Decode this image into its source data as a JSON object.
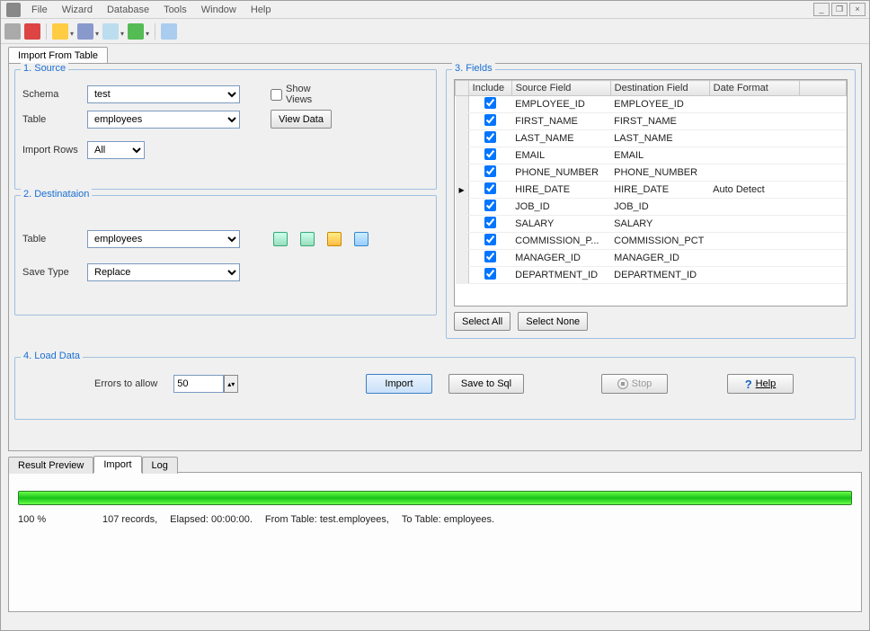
{
  "menu": {
    "items": [
      "File",
      "Wizard",
      "Database",
      "Tools",
      "Window",
      "Help"
    ]
  },
  "tab_main": "Import From Table",
  "source": {
    "legend": "1. Source",
    "schema_label": "Schema",
    "schema_value": "test",
    "table_label": "Table",
    "table_value": "employees",
    "show_views": "Show Views",
    "view_data": "View Data",
    "import_rows_label": "Import Rows",
    "import_rows_value": "All"
  },
  "dest": {
    "legend": "2. Destinataion",
    "table_label": "Table",
    "table_value": "employees",
    "save_type_label": "Save Type",
    "save_type_value": "Replace"
  },
  "fields": {
    "legend": "3. Fields",
    "headers": {
      "include": "Include",
      "source": "Source Field",
      "dest": "Destination Field",
      "datefmt": "Date Format"
    },
    "rows": [
      {
        "inc": true,
        "src": "EMPLOYEE_ID",
        "dst": "EMPLOYEE_ID",
        "fmt": "",
        "cur": false
      },
      {
        "inc": true,
        "src": "FIRST_NAME",
        "dst": "FIRST_NAME",
        "fmt": "",
        "cur": false
      },
      {
        "inc": true,
        "src": "LAST_NAME",
        "dst": "LAST_NAME",
        "fmt": "",
        "cur": false
      },
      {
        "inc": true,
        "src": "EMAIL",
        "dst": "EMAIL",
        "fmt": "",
        "cur": false
      },
      {
        "inc": true,
        "src": "PHONE_NUMBER",
        "dst": "PHONE_NUMBER",
        "fmt": "",
        "cur": false
      },
      {
        "inc": true,
        "src": "HIRE_DATE",
        "dst": "HIRE_DATE",
        "fmt": "Auto Detect",
        "cur": true
      },
      {
        "inc": true,
        "src": "JOB_ID",
        "dst": "JOB_ID",
        "fmt": "",
        "cur": false
      },
      {
        "inc": true,
        "src": "SALARY",
        "dst": "SALARY",
        "fmt": "",
        "cur": false
      },
      {
        "inc": true,
        "src": "COMMISSION_P...",
        "dst": "COMMISSION_PCT",
        "fmt": "",
        "cur": false
      },
      {
        "inc": true,
        "src": "MANAGER_ID",
        "dst": "MANAGER_ID",
        "fmt": "",
        "cur": false
      },
      {
        "inc": true,
        "src": "DEPARTMENT_ID",
        "dst": "DEPARTMENT_ID",
        "fmt": "",
        "cur": false
      }
    ],
    "select_all": "Select All",
    "select_none": "Select None"
  },
  "load": {
    "legend": "4. Load Data",
    "errors_label": "Errors to allow",
    "errors_value": "50",
    "import_btn": "Import",
    "save_sql": "Save to Sql",
    "stop": "Stop",
    "help": "Help"
  },
  "bottom_tabs": {
    "result": "Result Preview",
    "import": "Import",
    "log": "Log"
  },
  "progress": {
    "pct": "100 %",
    "records": "107 records,",
    "elapsed": "Elapsed: 00:00:00.",
    "from": "From Table: test.employees,",
    "to": "To Table: employees."
  }
}
